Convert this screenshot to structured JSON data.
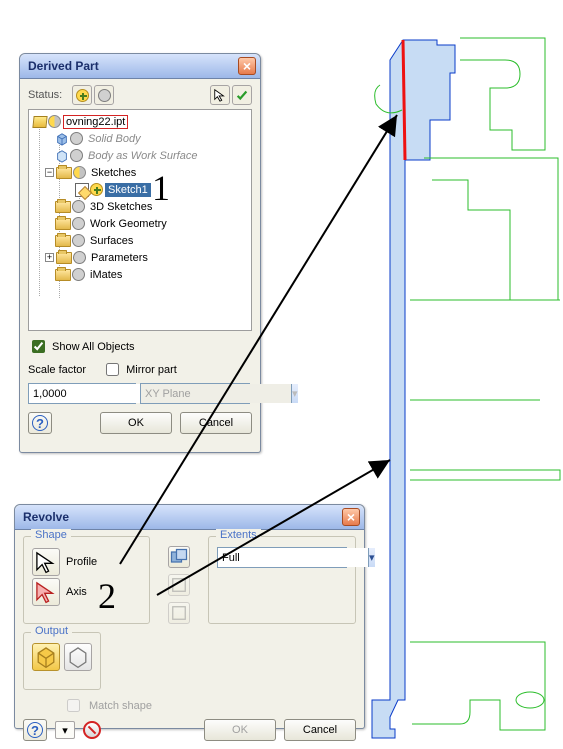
{
  "derived_part": {
    "title": "Derived Part",
    "status_label": "Status:",
    "tree": {
      "root": {
        "label": "ovning22.ipt"
      },
      "solid_body": {
        "label": "Solid Body"
      },
      "body_ws": {
        "label": "Body as Work Surface"
      },
      "sketches": {
        "label": "Sketches"
      },
      "sketch1": {
        "label": "Sketch1"
      },
      "sk3d": {
        "label": "3D Sketches"
      },
      "workgeo": {
        "label": "Work Geometry"
      },
      "surfaces": {
        "label": "Surfaces"
      },
      "params": {
        "label": "Parameters"
      },
      "imates": {
        "label": "iMates"
      }
    },
    "show_all": "Show All Objects",
    "scale_factor_label": "Scale factor",
    "mirror_label": "Mirror part",
    "scale_value": "1,0000",
    "plane_value": "XY Plane",
    "ok": "OK",
    "cancel": "Cancel"
  },
  "revolve": {
    "title": "Revolve",
    "shape_legend": "Shape",
    "profile_label": "Profile",
    "axis_label": "Axis",
    "output_legend": "Output",
    "match_shape": "Match shape",
    "extents_legend": "Extents",
    "extents_value": "Full",
    "ok": "OK",
    "cancel": "Cancel"
  },
  "annotations": {
    "one": "1",
    "two": "2"
  },
  "chart_data": null
}
